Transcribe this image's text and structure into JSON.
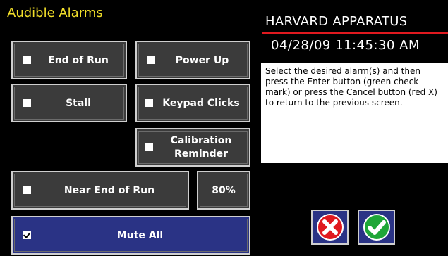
{
  "screen": {
    "title": "Audible Alarms"
  },
  "brand": "HARVARD APPARATUS",
  "datetime": "04/28/09 11:45:30 AM",
  "help_text": "Select the desired alarm(s) and then press the Enter button (green check mark) or press the Cancel button (red X) to return to the previous screen.",
  "alarms": {
    "end_of_run": {
      "label": "End of Run",
      "checked": false
    },
    "power_up": {
      "label": "Power Up",
      "checked": false
    },
    "stall": {
      "label": "Stall",
      "checked": false
    },
    "keypad_clicks": {
      "label": "Keypad Clicks",
      "checked": false
    },
    "calibration_reminder": {
      "label_line1": "Calibration",
      "label_line2": "Reminder",
      "checked": false
    },
    "near_end_of_run": {
      "label": "Near End of Run",
      "checked": false,
      "percent": "80%"
    },
    "mute_all": {
      "label": "Mute All",
      "checked": true
    }
  },
  "colors": {
    "title": "#f2df2a",
    "accent_red": "#e0191f",
    "button_face": "#3b3b3b",
    "selected_face": "#2a3385",
    "cancel": "#e0191f",
    "enter": "#1fa637"
  },
  "icons": {
    "cancel": "cancel-x-icon",
    "enter": "check-mark-icon"
  }
}
